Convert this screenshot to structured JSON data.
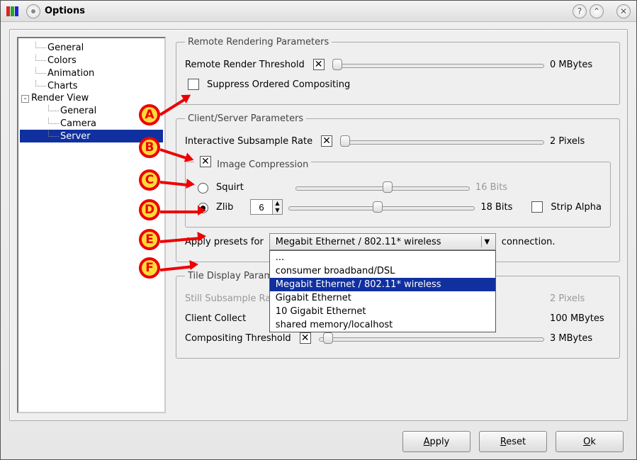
{
  "window": {
    "title": "Options"
  },
  "titlebar_buttons": {
    "help": "?",
    "collapse": "⌃",
    "close": "✕"
  },
  "tree": {
    "items": [
      {
        "label": "General",
        "level": 1
      },
      {
        "label": "Colors",
        "level": 1
      },
      {
        "label": "Animation",
        "level": 1
      },
      {
        "label": "Charts",
        "level": 1
      },
      {
        "label": "Render View",
        "level": 0,
        "expanded": true
      },
      {
        "label": "General",
        "level": 2
      },
      {
        "label": "Camera",
        "level": 2
      },
      {
        "label": "Server",
        "level": 2,
        "selected": true
      }
    ]
  },
  "remote": {
    "legend": "Remote Rendering Parameters",
    "threshold_label": "Remote Render Threshold",
    "threshold_checked": true,
    "threshold_pos_pct": 0,
    "threshold_value": "0 MBytes",
    "suppress_label": "Suppress Ordered Compositing",
    "suppress_checked": false
  },
  "cs": {
    "legend": "Client/Server Parameters",
    "subsample_label": "Interactive Subsample Rate",
    "subsample_checked": true,
    "subsample_pos_pct": 0,
    "subsample_value": "2 Pixels",
    "imgcomp_legend": "Image Compression",
    "imgcomp_checked": true,
    "squirt_label": "Squirt",
    "squirt_selected": false,
    "squirt_pos_pct": 50,
    "squirt_value": "16 Bits",
    "zlib_label": "Zlib",
    "zlib_selected": true,
    "zlib_level": "6",
    "zlib_pos_pct": 45,
    "zlib_value": "18 Bits",
    "strip_alpha_label": "Strip Alpha",
    "strip_alpha_checked": false,
    "preset_label_pre": "Apply presets for",
    "preset_label_post": "connection.",
    "preset_selected": "Megabit Ethernet / 802.11* wireless",
    "preset_options": [
      "...",
      "consumer broadband/DSL",
      "Megabit Ethernet / 802.11* wireless",
      "Gigabit Ethernet",
      "10 Gigabit Ethernet",
      "shared memory/localhost"
    ]
  },
  "tile": {
    "legend": "Tile Display Parameters",
    "still_label": "Still Subsample Rate",
    "still_value": "2 Pixels",
    "collect_label": "Client Collect",
    "collect_value": "100 MBytes",
    "compositing_label": "Compositing Threshold",
    "compositing_checked": true,
    "compositing_pos_pct": 2,
    "compositing_value": "3 MBytes"
  },
  "buttons": {
    "apply": "Apply",
    "reset": "Reset",
    "ok": "Ok"
  },
  "callouts": {
    "A": "A",
    "B": "B",
    "C": "C",
    "D": "D",
    "E": "E",
    "F": "F"
  }
}
